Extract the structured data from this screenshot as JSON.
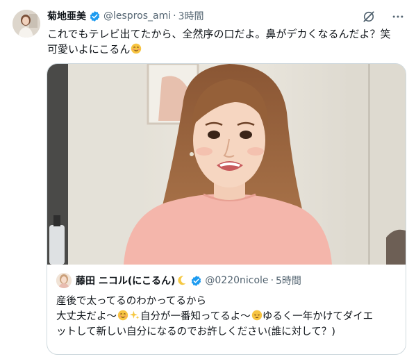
{
  "tweet": {
    "author_name": "菊地亜美",
    "author_handle": "@lespros_ami",
    "separator": "·",
    "time": "3時間",
    "text_line1": "これでもテレビ出てたから、全然序の口だよ。鼻がデカくなるんだよ？笑",
    "text_line2": "可愛いよにこるん"
  },
  "quote": {
    "author_name": "藤田 ニコル(にこるん)",
    "author_handle": "@0220nicole",
    "separator": "·",
    "time": "5時間",
    "line1": "産後で太ってるのわかってるから",
    "line2_a": "大丈夫だよ〜",
    "line2_b": "自分が一番知ってるよ〜",
    "line2_c": "ゆるく一年かけてダイエ",
    "line3": "ットして新しい自分になるのでお許しください(誰に対して？)"
  },
  "icons": {
    "verified": "verified-badge-icon",
    "grok": "grok-icon",
    "more": "more-options-icon",
    "smile_emoji": "smiling-face-emoji",
    "sparkles_emoji": "sparkles-emoji",
    "relieved_emoji": "relieved-face-emoji",
    "moon_emoji": "crescent-moon-emoji"
  },
  "colors": {
    "verified_blue": "#1d9bf0",
    "muted_text": "#536471",
    "border": "#cfd9de",
    "shirt_pink": "#f4b6ab"
  }
}
